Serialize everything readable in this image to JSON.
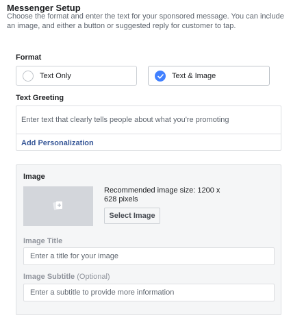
{
  "header": {
    "title": "Messenger Setup",
    "description": "Choose the format and enter the text for your sponsored message. You can include an image, and either a button or suggested reply for customer to tap."
  },
  "format": {
    "label": "Format",
    "options": [
      {
        "label": "Text Only",
        "selected": false
      },
      {
        "label": "Text & Image",
        "selected": true
      }
    ]
  },
  "greeting": {
    "label": "Text Greeting",
    "placeholder": "Enter text that clearly tells people about what you're promoting",
    "value": "",
    "add_personalization": "Add Personalization"
  },
  "image": {
    "heading": "Image",
    "recommended": "Recommended image size: 1200 x 628 pixels",
    "select_button": "Select Image",
    "placeholder_icon": "add-image-icon",
    "title_label": "Image Title",
    "title_placeholder": "Enter a title for your image",
    "title_value": "",
    "subtitle_label": "Image Subtitle",
    "subtitle_optional": "(Optional)",
    "subtitle_placeholder": "Enter a subtitle to provide more information",
    "subtitle_value": ""
  },
  "colors": {
    "accent": "#4080ff",
    "link": "#385898",
    "panel_bg": "#f5f6f7",
    "placeholder_bg": "#d3d6db"
  }
}
